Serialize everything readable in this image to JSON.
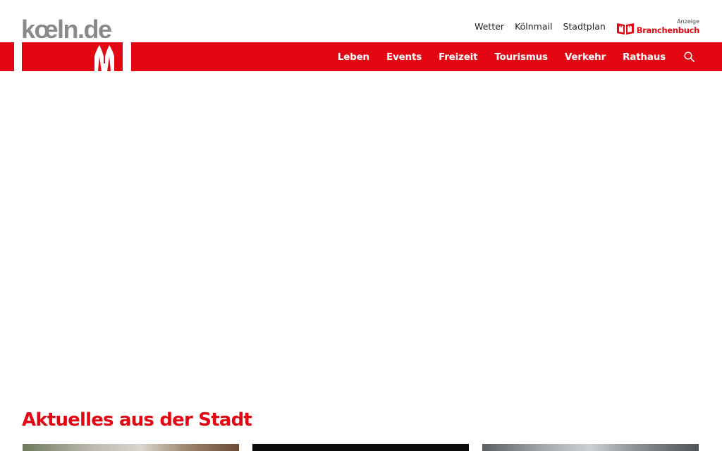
{
  "header": {
    "logo_text": "kœln.de",
    "utility_links": [
      "Wetter",
      "Kölnmail",
      "Stadtplan"
    ],
    "branchenbuch": {
      "anzeige": "Anzeige",
      "label": "Branchenbuch"
    },
    "icons": {
      "logo_mark": "cathedral-icon",
      "branchenbuch": "book-icon",
      "search": "search-icon"
    }
  },
  "main_nav": {
    "items": [
      "Leben",
      "Events",
      "Freizeit",
      "Tourismus",
      "Verkehr",
      "Rathaus"
    ]
  },
  "section": {
    "title": "Aktuelles aus der Stadt"
  },
  "colors": {
    "brand_red": "#e30613",
    "logo_gray": "#8a8a8a",
    "text_dark": "#222222"
  }
}
